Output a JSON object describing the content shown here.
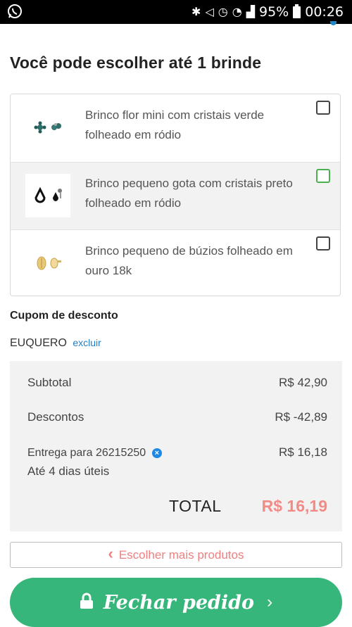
{
  "status_bar": {
    "battery": "95%",
    "time": "00:26"
  },
  "page_title": "Você pode escolher até 1 brinde",
  "gifts": [
    {
      "name": "Brinco flor mini com cristais verde folheado em ródio",
      "checked": false
    },
    {
      "name": "Brinco pequeno gota com cristais preto folheado em ródio",
      "checked": false,
      "highlighted": true
    },
    {
      "name": "Brinco pequeno de búzios folheado em ouro 18k",
      "checked": false
    }
  ],
  "coupon": {
    "title": "Cupom de desconto",
    "code": "EUQUERO",
    "remove_label": "excluir"
  },
  "summary": {
    "subtotal_label": "Subtotal",
    "subtotal_value": "R$ 42,90",
    "discount_label": "Descontos",
    "discount_value": "R$ -42,89",
    "delivery_label": "Entrega para 26215250",
    "delivery_value": "R$ 16,18",
    "delivery_days": "Até 4 dias úteis",
    "total_label": "TOTAL",
    "total_value": "R$ 16,19"
  },
  "buttons": {
    "more_products": "Escolher mais produtos",
    "checkout": "Fechar pedido"
  },
  "colors": {
    "checkout": "#36b67a",
    "total": "#f28b86",
    "link": "#1e7fc4",
    "selected_checkbox": "#4caf50"
  }
}
